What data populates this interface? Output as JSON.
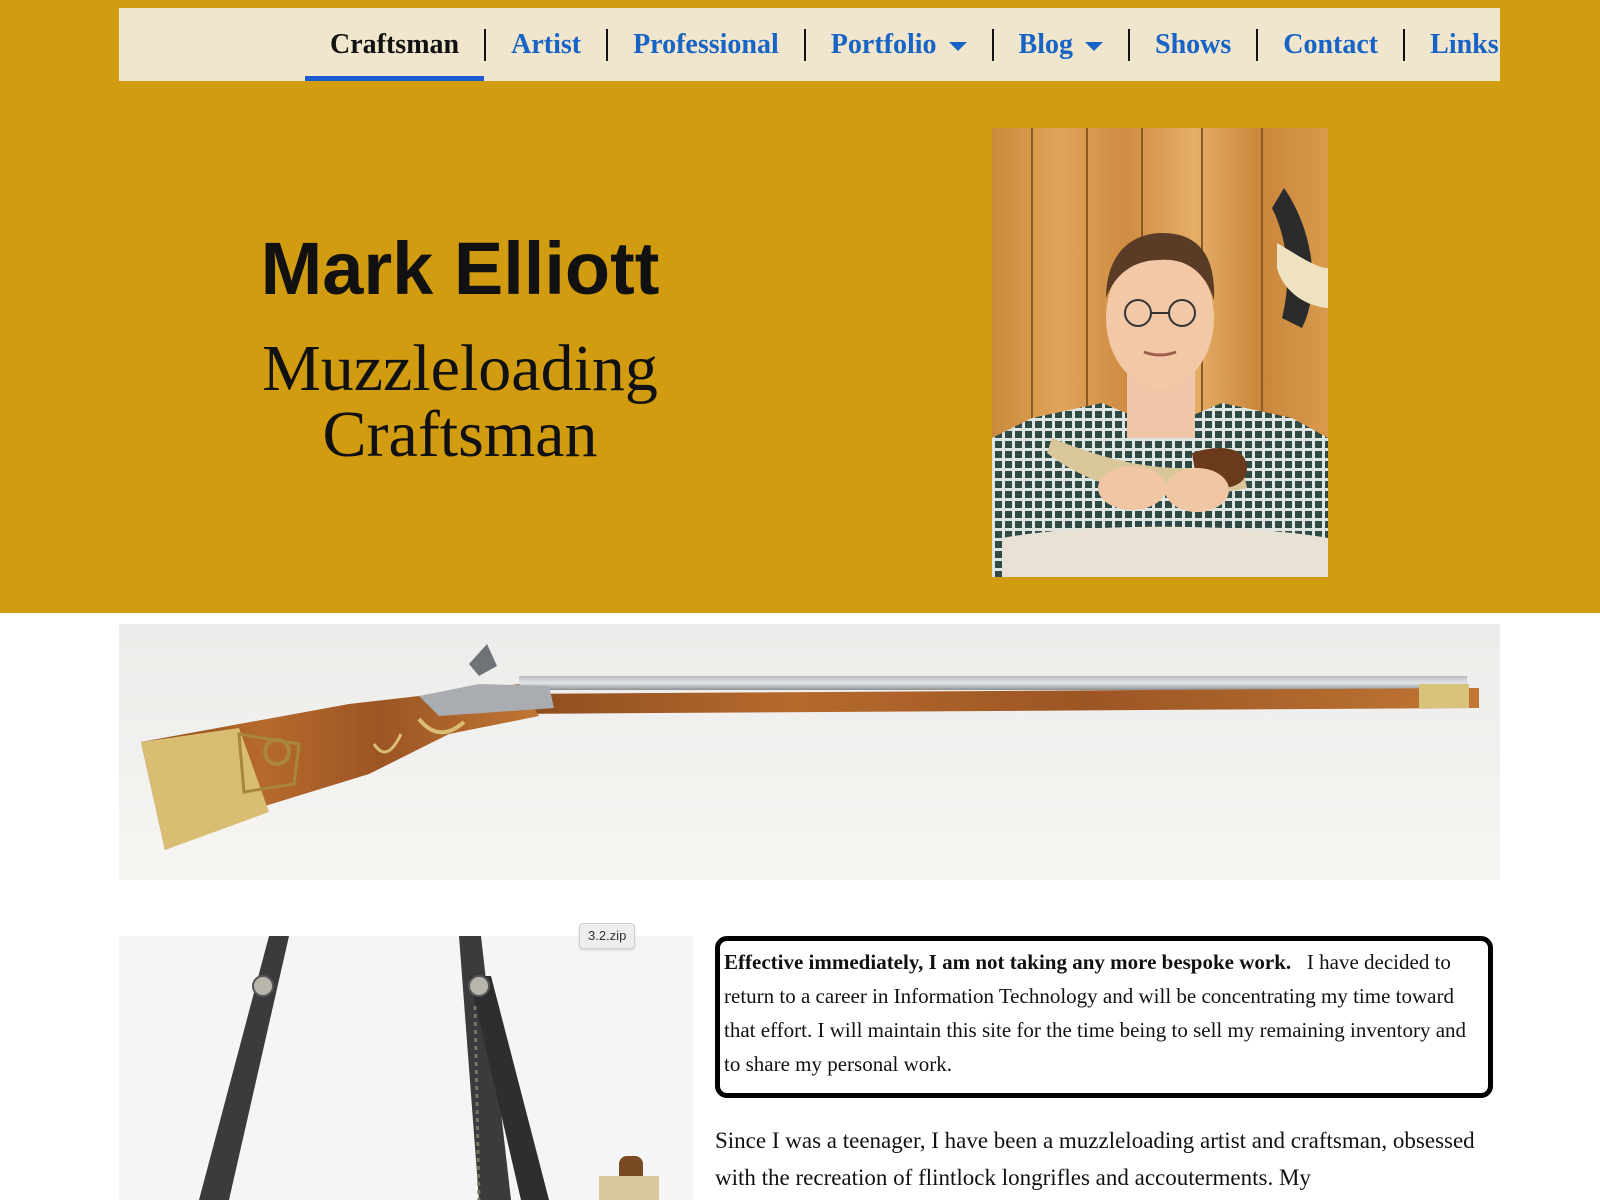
{
  "nav": {
    "items": [
      {
        "label": "Craftsman",
        "active": true,
        "dropdown": false
      },
      {
        "label": "Artist",
        "active": false,
        "dropdown": false
      },
      {
        "label": "Professional",
        "active": false,
        "dropdown": false
      },
      {
        "label": "Portfolio",
        "active": false,
        "dropdown": true
      },
      {
        "label": "Blog",
        "active": false,
        "dropdown": true
      },
      {
        "label": "Shows",
        "active": false,
        "dropdown": false
      },
      {
        "label": "Contact",
        "active": false,
        "dropdown": false
      },
      {
        "label": "Links",
        "active": false,
        "dropdown": false
      }
    ]
  },
  "hero": {
    "name": "Mark Elliott",
    "subtitle_line1": "Muzzleloading",
    "subtitle_line2": "Craftsman"
  },
  "tooltip": {
    "text": "3.2.zip"
  },
  "notice": {
    "bold": "Effective immediately, I am not taking any more bespoke work.",
    "text": "I have decided to return to a career in Information Technology and will be concentrating my time toward that effort.   I will maintain this site for the time being to sell my remaining inventory and to share my personal work."
  },
  "intro": {
    "text": "Since I was a teenager,  I have been a muzzleloading artist and craftsman, obsessed with the recreation of flintlock longrifles and accouterments. My"
  },
  "colors": {
    "hero_background": "#d19c0f",
    "nav_background": "#f0e5cd",
    "nav_link": "#1763c6",
    "active_underline": "#1a5bd0"
  }
}
